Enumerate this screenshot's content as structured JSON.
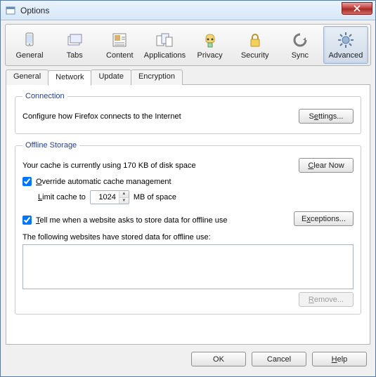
{
  "window": {
    "title": "Options"
  },
  "toolbar": {
    "items": [
      {
        "label": "General"
      },
      {
        "label": "Tabs"
      },
      {
        "label": "Content"
      },
      {
        "label": "Applications"
      },
      {
        "label": "Privacy"
      },
      {
        "label": "Security"
      },
      {
        "label": "Sync"
      },
      {
        "label": "Advanced"
      }
    ]
  },
  "subtabs": {
    "items": [
      {
        "label": "General"
      },
      {
        "label": "Network"
      },
      {
        "label": "Update"
      },
      {
        "label": "Encryption"
      }
    ]
  },
  "connection": {
    "legend": "Connection",
    "desc": "Configure how Firefox connects to the Internet",
    "settings_btn": "Settings..."
  },
  "offline": {
    "legend": "Offline Storage",
    "usage_text": "Your cache is currently using 170 KB of disk space",
    "clear_btn": "Clear Now",
    "override_label": "Override automatic cache management",
    "limit_label_pre": "Limit cache to",
    "limit_value": "1024",
    "limit_label_post": "MB of space",
    "tell_label": "Tell me when a website asks to store data for offline use",
    "exceptions_btn": "Exceptions...",
    "stored_label": "The following websites have stored data for offline use:",
    "remove_btn": "Remove..."
  },
  "footer": {
    "ok": "OK",
    "cancel": "Cancel",
    "help": "Help"
  }
}
